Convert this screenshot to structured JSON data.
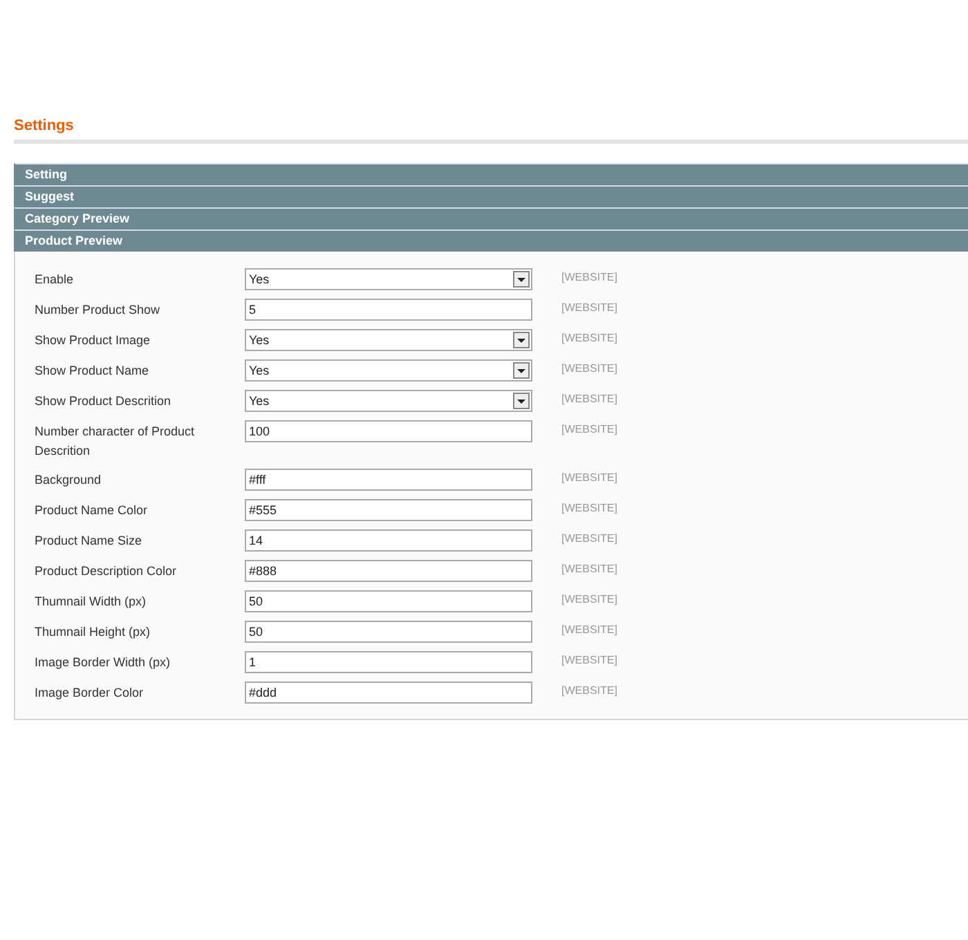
{
  "page_title": "Settings",
  "sections": [
    {
      "title": "Setting"
    },
    {
      "title": "Suggest"
    },
    {
      "title": "Category Preview"
    },
    {
      "title": "Product Preview",
      "fields": [
        {
          "label": "Enable",
          "kind": "select",
          "value": "Yes",
          "scope": "[WEBSITE]"
        },
        {
          "label": "Number Product Show",
          "kind": "text",
          "value": "5",
          "scope": "[WEBSITE]"
        },
        {
          "label": "Show Product Image",
          "kind": "select",
          "value": "Yes",
          "scope": "[WEBSITE]"
        },
        {
          "label": "Show Product Name",
          "kind": "select",
          "value": "Yes",
          "scope": "[WEBSITE]"
        },
        {
          "label": "Show Product Descrition",
          "kind": "select",
          "value": "Yes",
          "scope": "[WEBSITE]"
        },
        {
          "label": "Number character of Product Descrition",
          "kind": "text",
          "value": "100",
          "scope": "[WEBSITE]"
        },
        {
          "label": "Background",
          "kind": "text",
          "value": "#fff",
          "scope": "[WEBSITE]"
        },
        {
          "label": "Product Name Color",
          "kind": "text",
          "value": "#555",
          "scope": "[WEBSITE]"
        },
        {
          "label": "Product Name Size",
          "kind": "text",
          "value": "14",
          "scope": "[WEBSITE]"
        },
        {
          "label": "Product Description Color",
          "kind": "text",
          "value": "#888",
          "scope": "[WEBSITE]"
        },
        {
          "label": "Thumnail Width (px)",
          "kind": "text",
          "value": "50",
          "scope": "[WEBSITE]"
        },
        {
          "label": "Thumnail Height (px)",
          "kind": "text",
          "value": "50",
          "scope": "[WEBSITE]"
        },
        {
          "label": "Image Border Width (px)",
          "kind": "text",
          "value": "1",
          "scope": "[WEBSITE]"
        },
        {
          "label": "Image Border Color",
          "kind": "text",
          "value": "#ddd",
          "scope": "[WEBSITE]"
        }
      ]
    }
  ]
}
